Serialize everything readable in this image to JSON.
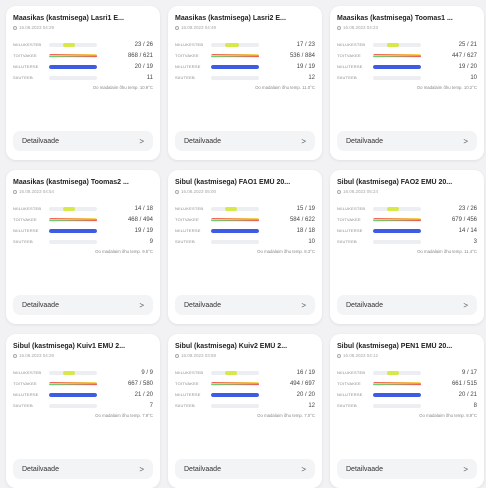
{
  "labels": {
    "row1": "NIILUKESTEB",
    "row2": "TOITVAKEE",
    "row3": "NIILUTERSE",
    "row4": "SIIUTEEB",
    "temp_prefix": "Oo madalaim õhu temp.",
    "details": "Detailvaade",
    "chevron": ">"
  },
  "colors": {
    "green": "#d7e84a",
    "red": "#ef4a5a",
    "blue": "#3d5be5",
    "gradient_green": "#64d673",
    "gradient_yellow": "#f2e14c",
    "gradient_red": "#f05a5a"
  },
  "cards": [
    {
      "title": "Maasikas (kastmisega) Lasri1 E...",
      "date": "16.08.2023 04:29",
      "values": [
        "23 / 26",
        "868 / 621",
        "20 / 19",
        "11"
      ],
      "fills": [
        0.6,
        1.0,
        1.0,
        0
      ],
      "temp": "10.9°C"
    },
    {
      "title": "Maasikas (kastmisega) Lasri2 E...",
      "date": "16.08.2023 04:49",
      "values": [
        "17 / 23",
        "536 / 884",
        "19 / 19",
        "12"
      ],
      "fills": [
        0.7,
        1.0,
        1.0,
        0
      ],
      "temp": "11.0°C"
    },
    {
      "title": "Maasikas (kastmisega) Toomas1 ...",
      "date": "16.08.2023 04:23",
      "values": [
        "25 / 21",
        "447 / 627",
        "19 / 20",
        "10"
      ],
      "fills": [
        0.6,
        1.0,
        1.0,
        0
      ],
      "temp": "10.2°C"
    },
    {
      "title": "Maasikas (kastmisega) Toomas2 ...",
      "date": "16.08.2023 04:54",
      "values": [
        "14 / 18",
        "468 / 494",
        "19 / 19",
        "9"
      ],
      "fills": [
        0.6,
        1.0,
        1.0,
        0
      ],
      "temp": "9.5°C"
    },
    {
      "title": "Sibul (kastmisega) FAO1 EMÜ 20...",
      "date": "16.08.2023 05:00",
      "values": [
        "15 / 19",
        "584 / 622",
        "18 / 18",
        "10"
      ],
      "fills": [
        0.6,
        1.0,
        1.0,
        0
      ],
      "temp": "8.3°C"
    },
    {
      "title": "Sibul (kastmisega) FAO2 EMÜ 20...",
      "date": "16.08.2023 05:24",
      "values": [
        "23 / 26",
        "679 / 456",
        "14 / 14",
        "3"
      ],
      "fills": [
        0.6,
        1.0,
        1.0,
        0
      ],
      "temp": "11.4°C"
    },
    {
      "title": "Sibul (kastmisega) Kuiv1 EMÜ 2...",
      "date": "16.08.2023 04:28",
      "values": [
        "9 / 9",
        "667 / 580",
        "21 / 20",
        "7"
      ],
      "fills": [
        0.6,
        1.0,
        1.0,
        0
      ],
      "temp": "7.9°C"
    },
    {
      "title": "Sibul (kastmisega) Kuiv2 EMÜ 2...",
      "date": "16.08.2023 03:59",
      "values": [
        "16 / 19",
        "494 / 697",
        "20 / 20",
        "12"
      ],
      "fills": [
        0.6,
        1.0,
        1.0,
        0
      ],
      "temp": "7.0°C"
    },
    {
      "title": "Sibul (kastmisega) PEN1 EMÜ 20...",
      "date": "16.08.2023 04:12",
      "values": [
        "9 / 17",
        "661 / 515",
        "20 / 21",
        "8"
      ],
      "fills": [
        0.6,
        1.0,
        1.0,
        0
      ],
      "temp": "8.9°C"
    }
  ]
}
